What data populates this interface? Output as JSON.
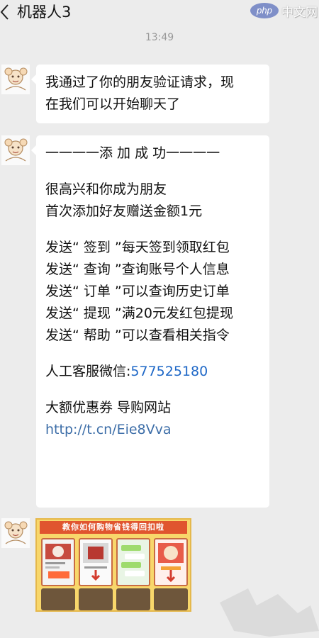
{
  "header": {
    "title": "机器人3",
    "back_icon": "chevron-left-icon",
    "watermark": {
      "logo": "php",
      "text": "中文网"
    }
  },
  "chat": {
    "timestamp": "13:49",
    "messages": [
      {
        "avatar": "robot-avatar",
        "lines": [
          "我通过了你的朋友验证请求，现",
          "在我们可以开始聊天了"
        ]
      },
      {
        "avatar": "robot-avatar",
        "title": "一一一一添 加 成 功一一一一",
        "greeting": [
          "很高兴和你成为朋友",
          "首次添加好友赠送金额1元"
        ],
        "commands": [
          "发送“ 签到 ”每天签到领取红包",
          "发送“ 查询 ”查询账号个人信息",
          "发送“ 订单 ”可以查询历史订单",
          "发送“ 提现 ”满20元发红包提现",
          "发送“ 帮助 ”可以查看相关指令"
        ],
        "service_label": "人工客服微信:",
        "service_id": "577525180",
        "coupon_label": "大额优惠券 导购网站",
        "link": "http://t.cn/Eie8Vva"
      },
      {
        "avatar": "robot-avatar",
        "image": "tutorial-poster",
        "poster_title": "教你如何购物省钱得回扣啦"
      }
    ]
  },
  "colors": {
    "background": "#ececec",
    "bubble": "#ffffff",
    "link": "#3d6ea8"
  }
}
